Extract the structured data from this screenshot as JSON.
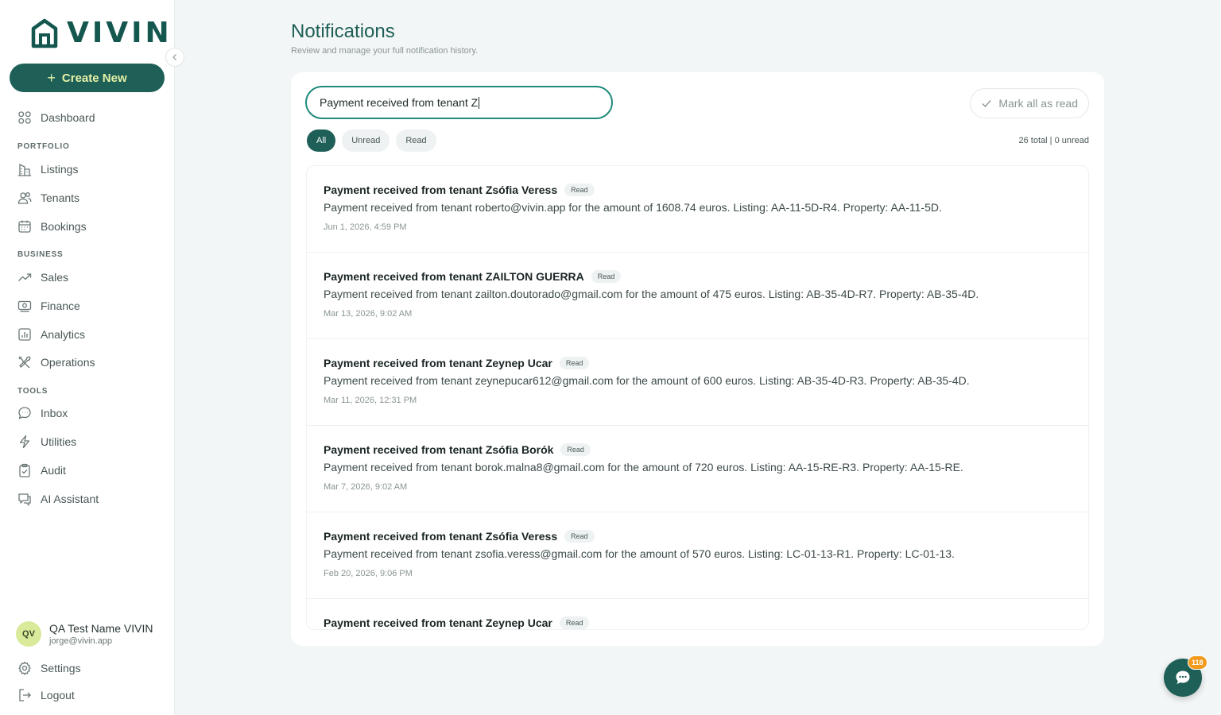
{
  "app": {
    "logo_text": "VIVIN"
  },
  "sidebar": {
    "create_label": "Create New",
    "dashboard": "Dashboard",
    "sections": {
      "portfolio": "PORTFOLIO",
      "business": "BUSINESS",
      "tools": "TOOLS"
    },
    "portfolio_items": [
      "Listings",
      "Tenants",
      "Bookings"
    ],
    "business_items": [
      "Sales",
      "Finance",
      "Analytics",
      "Operations"
    ],
    "tools_items": [
      "Inbox",
      "Utilities",
      "Audit",
      "AI Assistant"
    ],
    "user": {
      "initials": "QV",
      "name": "QA Test Name VIVIN",
      "email": "jorge@vivin.app"
    },
    "settings": "Settings",
    "logout": "Logout"
  },
  "main": {
    "title": "Notifications",
    "subtitle": "Review and manage your full notification history.",
    "search_value": "Payment received from tenant Z",
    "mark_all_label": "Mark all as read",
    "filters": [
      "All",
      "Unread",
      "Read"
    ],
    "active_filter": "All",
    "counts": "26 total | 0 unread"
  },
  "notifications": [
    {
      "title": "Payment received from tenant Zsófia Veress",
      "status": "Read",
      "message": "Payment received from tenant roberto@vivin.app for the amount of 1608.74 euros. Listing: AA-11-5D-R4. Property: AA-11-5D.",
      "time": "Jun 1, 2026, 4:59 PM"
    },
    {
      "title": "Payment received from tenant ZAILTON GUERRA",
      "status": "Read",
      "message": "Payment received from tenant zailton.doutorado@gmail.com for the amount of 475 euros. Listing: AB-35-4D-R7. Property: AB-35-4D.",
      "time": "Mar 13, 2026, 9:02 AM"
    },
    {
      "title": "Payment received from tenant Zeynep Ucar",
      "status": "Read",
      "message": "Payment received from tenant zeynepucar612@gmail.com for the amount of 600 euros. Listing: AB-35-4D-R3. Property: AB-35-4D.",
      "time": "Mar 11, 2026, 12:31 PM"
    },
    {
      "title": "Payment received from tenant Zsófia Borók",
      "status": "Read",
      "message": "Payment received from tenant borok.malna8@gmail.com for the amount of 720 euros. Listing: AA-15-RE-R3. Property: AA-15-RE.",
      "time": "Mar 7, 2026, 9:02 AM"
    },
    {
      "title": "Payment received from tenant Zsófia Veress",
      "status": "Read",
      "message": "Payment received from tenant zsofia.veress@gmail.com for the amount of 570 euros. Listing: LC-01-13-R1. Property: LC-01-13.",
      "time": "Feb 20, 2026, 9:06 PM"
    },
    {
      "title": "Payment received from tenant Zeynep Ucar",
      "status": "Read",
      "message": "",
      "time": ""
    }
  ],
  "chat": {
    "badge": "118"
  },
  "colors": {
    "brand": "#1e5f57",
    "accent": "#d9ea9a",
    "focus": "#1f8a7a",
    "badge": "#f29a1d"
  }
}
